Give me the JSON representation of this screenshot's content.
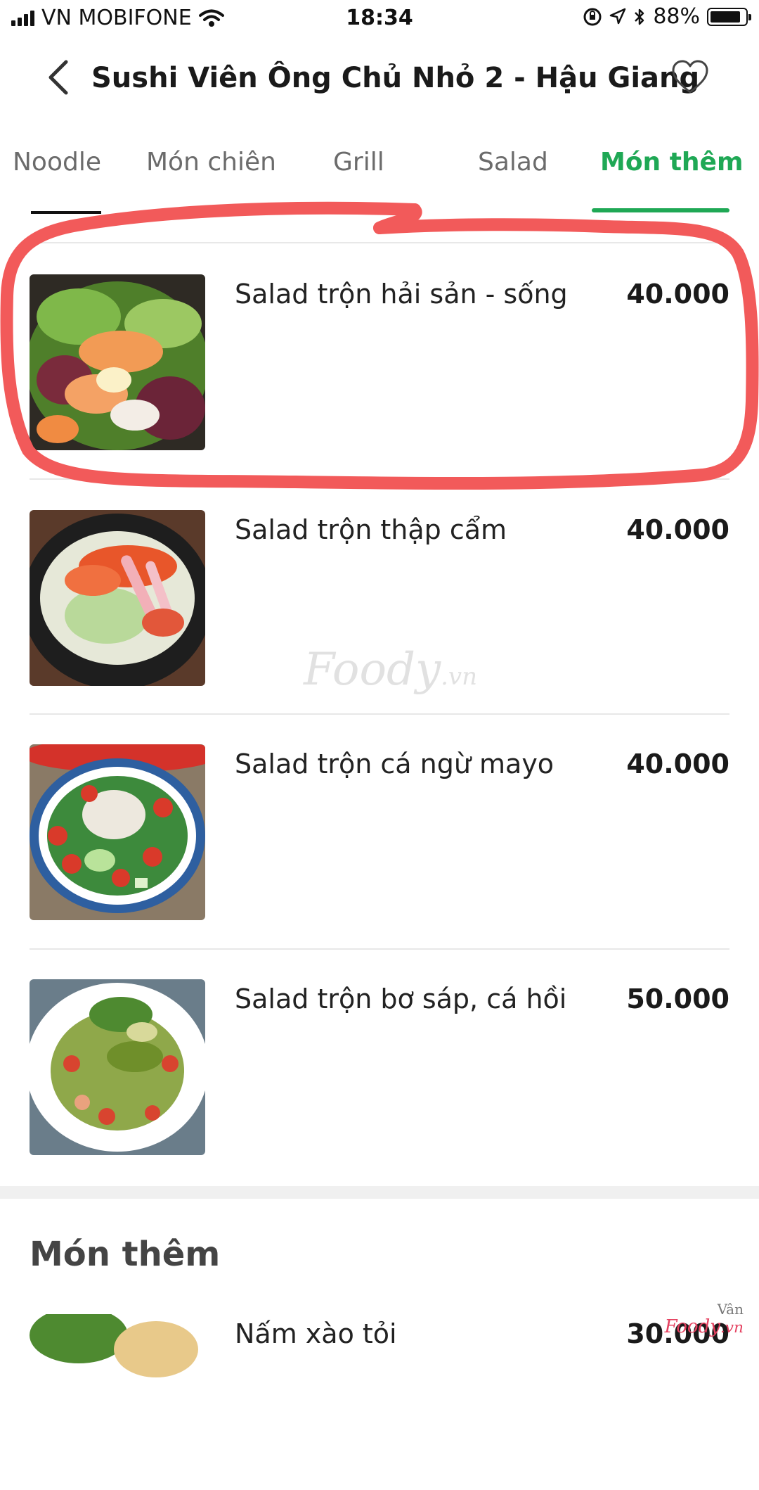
{
  "status_bar": {
    "carrier": "VN MOBIFONE",
    "time": "18:34",
    "battery": "88%",
    "battery_level": 0.88
  },
  "header": {
    "title": "Sushi Viên Ông Chủ Nhỏ 2 - Hậu Giang",
    "back_icon": "chevron-left-icon",
    "favorite_icon": "heart-outline-icon"
  },
  "tabs": [
    {
      "label": "Noodle",
      "active": false
    },
    {
      "label": "Món chiên",
      "active": false
    },
    {
      "label": "Grill",
      "active": false
    },
    {
      "label": "Salad",
      "active": false
    },
    {
      "label": "Món thêm",
      "active": true
    }
  ],
  "menu_items": [
    {
      "name": "Salad trộn hải sản - sống",
      "price": "40.000"
    },
    {
      "name": "Salad trộn thập cẩm",
      "price": "40.000"
    },
    {
      "name": "Salad trộn cá ngừ mayo",
      "price": "40.000"
    },
    {
      "name": "Salad trộn bơ sáp, cá hồi",
      "price": "50.000"
    }
  ],
  "section": {
    "title": "Món thêm",
    "items": [
      {
        "name": "Nấm xào tỏi",
        "price": "30.000"
      }
    ]
  },
  "watermark": {
    "brand": "Foody",
    "suffix": ".vn",
    "author": "Vân"
  },
  "colors": {
    "accent": "#1fa855",
    "highlight": "#f25a5a"
  }
}
